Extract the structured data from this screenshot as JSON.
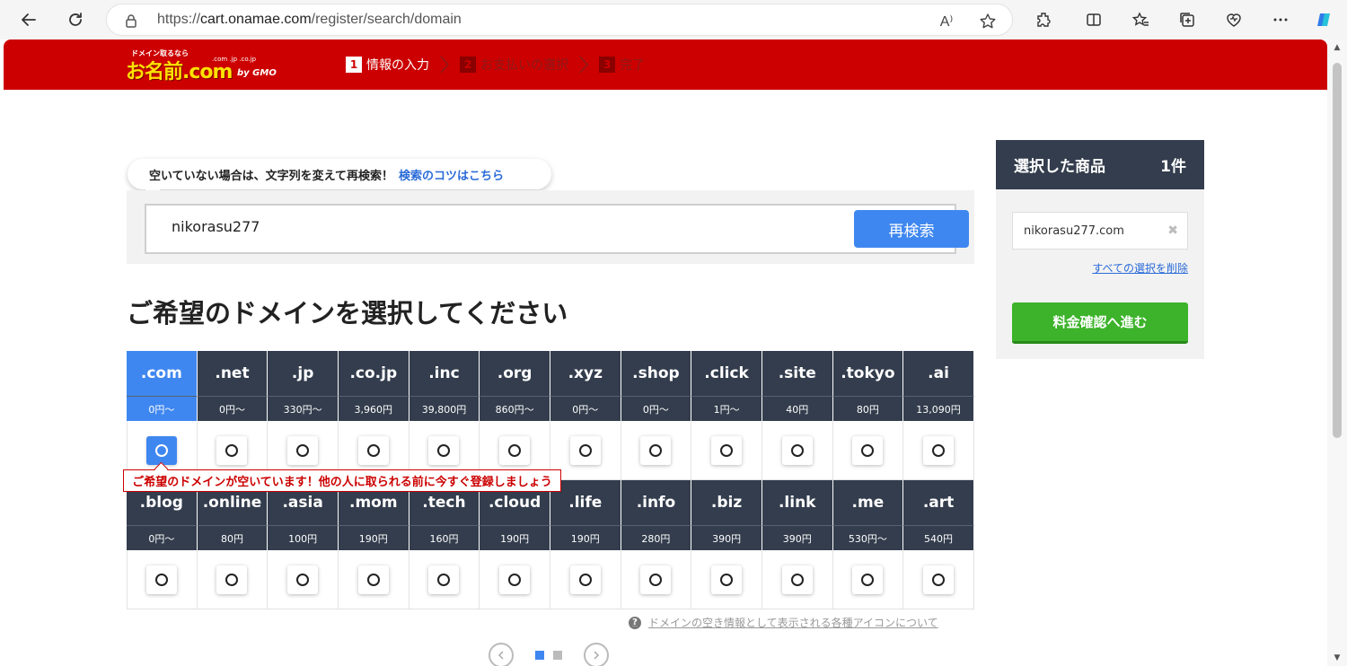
{
  "browser": {
    "url_prefix": "https://",
    "url_host": "cart.onamae.com",
    "url_path": "/register/search/domain",
    "read_aloud": "A⁾"
  },
  "header": {
    "logo_tag": "ドメイン取るなら",
    "logo_main": "お名前.com",
    "logo_tlds": ".com .jp .co.jp",
    "logo_by": "by GMO",
    "steps": [
      {
        "num": "1",
        "label": "情報の入力"
      },
      {
        "num": "2",
        "label": "お支払いの選択"
      },
      {
        "num": "3",
        "label": "完了"
      }
    ]
  },
  "search": {
    "hint_text": "空いていない場合は、文字列を変えて再検索！",
    "hint_link": "検索のコツはこちら",
    "query": "nikorasu277",
    "button": "再検索"
  },
  "section_title": "ご希望のドメインを選択してください",
  "domains_row1": [
    {
      "tld": ".com",
      "price": "0円〜",
      "selected": true
    },
    {
      "tld": ".net",
      "price": "0円〜",
      "selected": false
    },
    {
      "tld": ".jp",
      "price": "330円〜",
      "selected": false
    },
    {
      "tld": ".co.jp",
      "price": "3,960円",
      "selected": false
    },
    {
      "tld": ".inc",
      "price": "39,800円",
      "selected": false
    },
    {
      "tld": ".org",
      "price": "860円〜",
      "selected": false
    },
    {
      "tld": ".xyz",
      "price": "0円〜",
      "selected": false
    },
    {
      "tld": ".shop",
      "price": "0円〜",
      "selected": false
    },
    {
      "tld": ".click",
      "price": "1円〜",
      "selected": false
    },
    {
      "tld": ".site",
      "price": "40円",
      "selected": false
    },
    {
      "tld": ".tokyo",
      "price": "80円",
      "selected": false
    },
    {
      "tld": ".ai",
      "price": "13,090円",
      "selected": false
    }
  ],
  "domains_row2": [
    {
      "tld": ".blog",
      "price": "0円〜",
      "selected": false
    },
    {
      "tld": ".online",
      "price": "80円",
      "selected": false
    },
    {
      "tld": ".asia",
      "price": "100円",
      "selected": false
    },
    {
      "tld": ".mom",
      "price": "190円",
      "selected": false
    },
    {
      "tld": ".tech",
      "price": "160円",
      "selected": false
    },
    {
      "tld": ".cloud",
      "price": "190円",
      "selected": false
    },
    {
      "tld": ".life",
      "price": "190円",
      "selected": false
    },
    {
      "tld": ".info",
      "price": "280円",
      "selected": false
    },
    {
      "tld": ".biz",
      "price": "390円",
      "selected": false
    },
    {
      "tld": ".link",
      "price": "390円",
      "selected": false
    },
    {
      "tld": ".me",
      "price": "530円〜",
      "selected": false
    },
    {
      "tld": ".art",
      "price": "540円",
      "selected": false
    }
  ],
  "availability_tip": "ご希望のドメインが空いています！他の人に取られる前に今すぐ登録しましょう",
  "icon_note": "ドメインの空き情報として表示される各種アイコンについて",
  "icon_note_mark": "?",
  "cart": {
    "title": "選択した商品",
    "count": "1件",
    "item": "nikorasu277.com",
    "remove_mark": "✖",
    "clear_all": "すべての選択を削除",
    "proceed": "料金確認へ進む"
  },
  "colors": {
    "brand_red": "#cc0000",
    "selected_blue": "#3f87f0",
    "header_navy": "#333d4d",
    "proceed_green": "#3cb32a"
  }
}
